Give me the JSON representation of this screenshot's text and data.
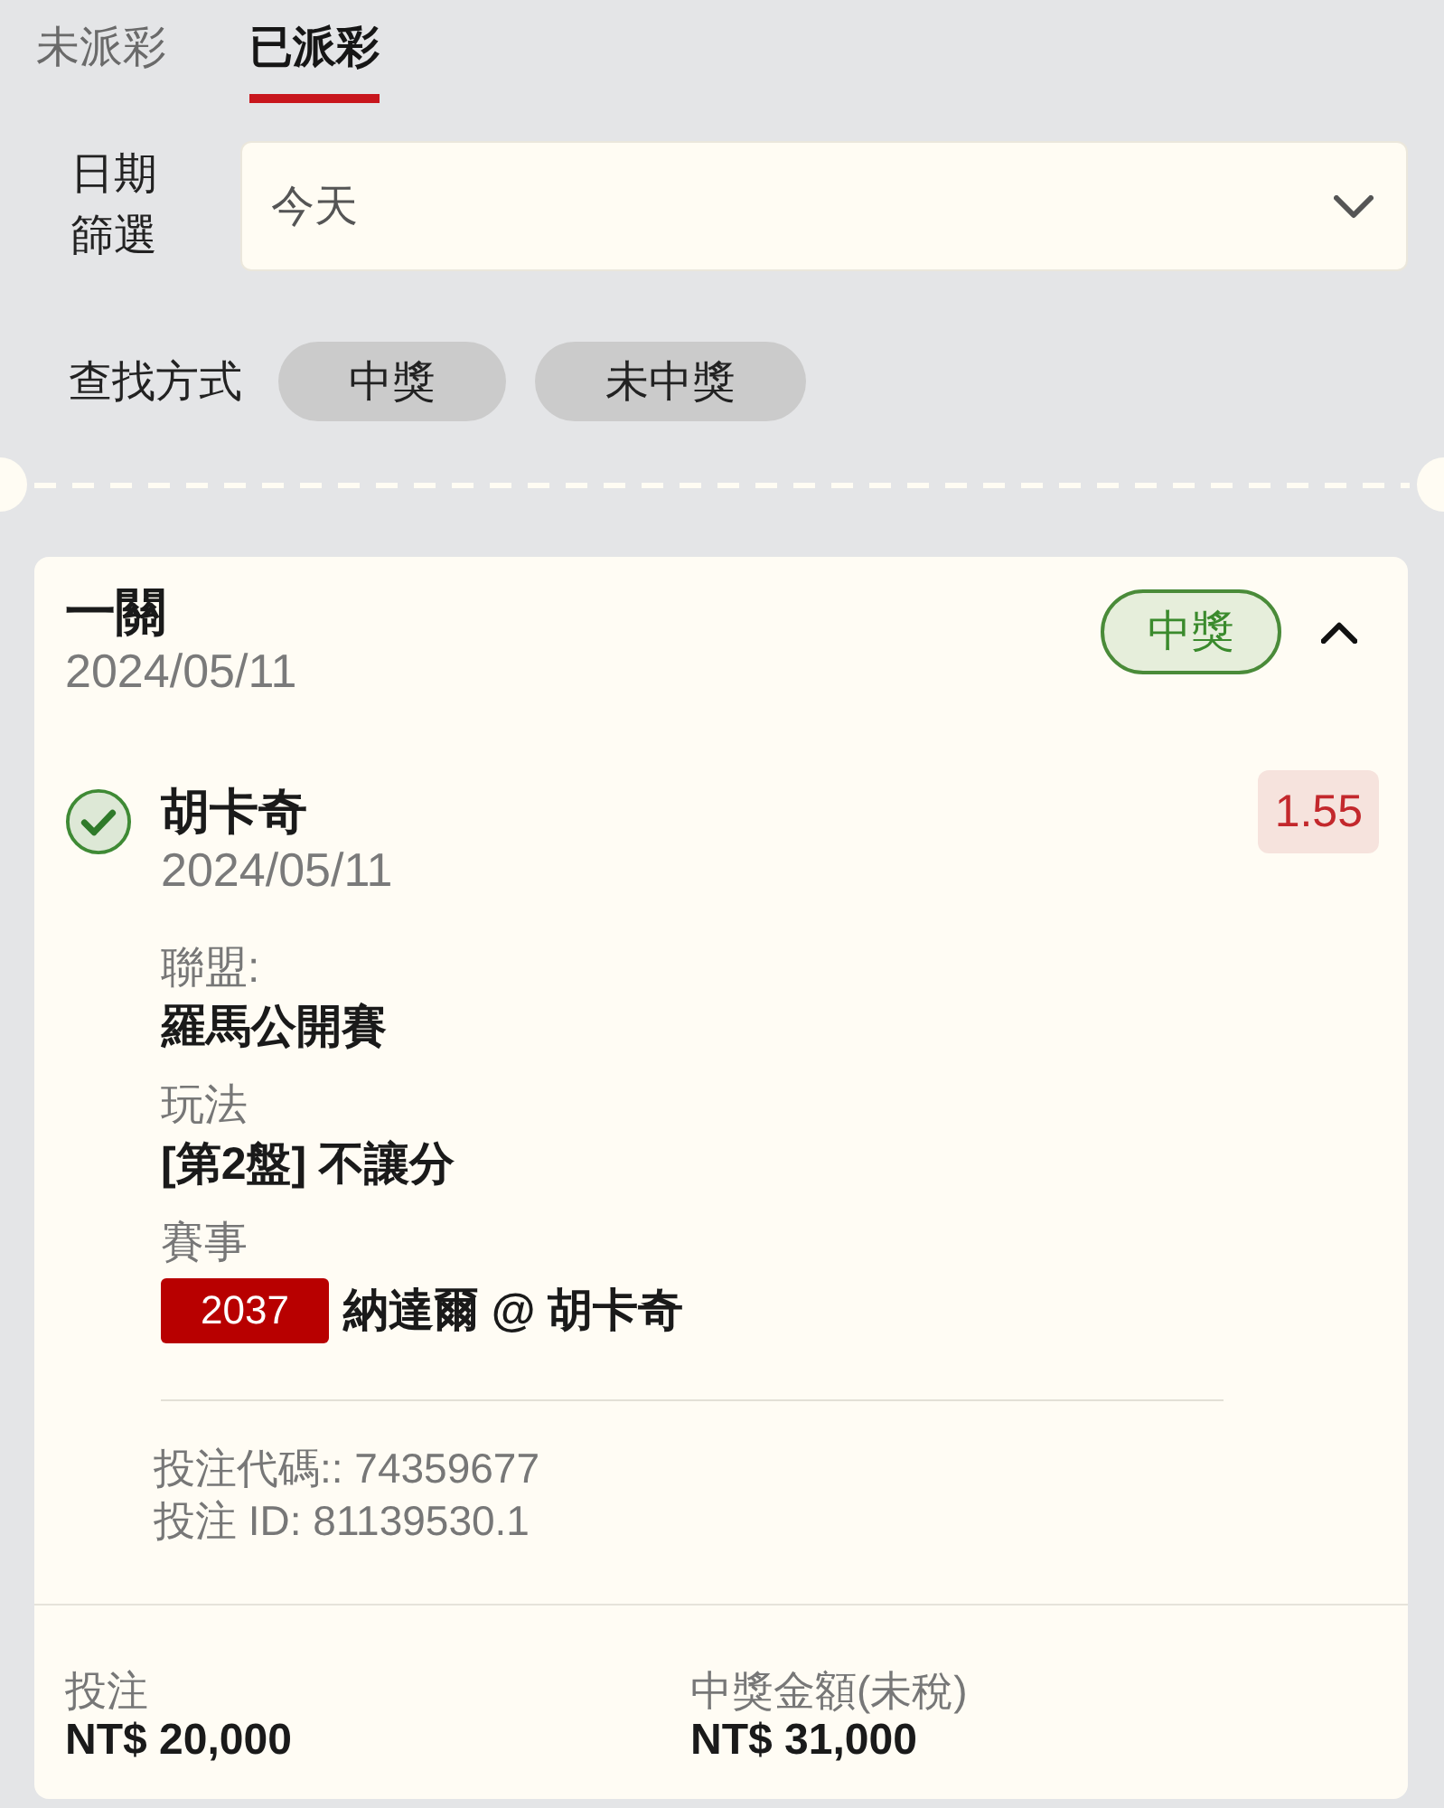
{
  "tabs": [
    {
      "label": "未派彩",
      "selected": false
    },
    {
      "label": "已派彩",
      "selected": true
    }
  ],
  "date_filter": {
    "label": "日期篩選",
    "value": "今天"
  },
  "search_by": {
    "label": "查找方式",
    "options": [
      {
        "label": "中獎",
        "selected": false
      },
      {
        "label": "未中獎",
        "selected": false
      }
    ]
  },
  "bet": {
    "type": "一關",
    "date": "2024/05/11",
    "status": {
      "label": "中獎",
      "kind": "won"
    },
    "expanded": true,
    "selections": [
      {
        "won": true,
        "name": "胡卡奇",
        "date": "2024/05/11",
        "odds": "1.55",
        "fields": [
          {
            "label": "聯盟:",
            "value": "羅馬公開賽"
          },
          {
            "label": "玩法",
            "value": "[第2盤] 不讓分"
          },
          {
            "label": "賽事",
            "code": "2037",
            "value": "納達爾 @ 胡卡奇"
          }
        ],
        "bet_code": "投注代碼:: 74359677",
        "bet_id": "投注 ID: 81139530.1"
      }
    ],
    "summary": [
      {
        "label": "投注",
        "value": "NT$ 20,000"
      },
      {
        "label": "中獎金額(未稅)",
        "value": "NT$ 31,000"
      }
    ]
  }
}
